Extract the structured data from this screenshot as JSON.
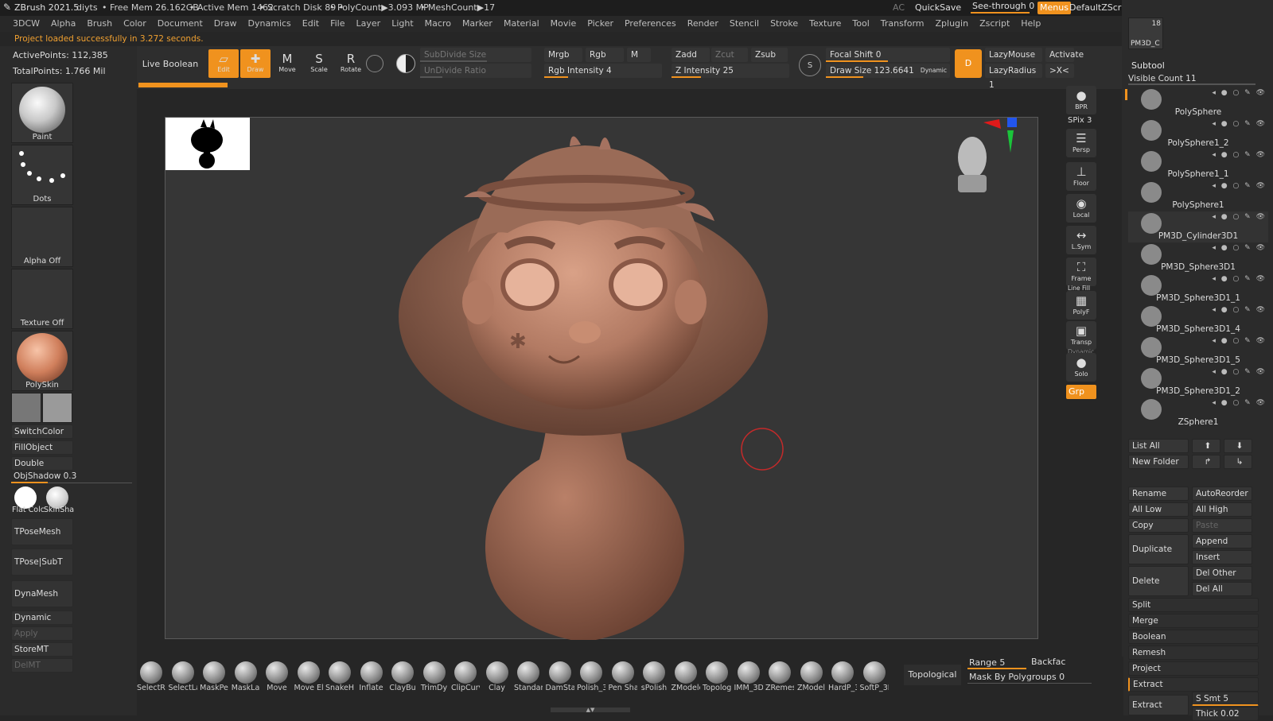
{
  "titlebar": {
    "app": "ZBrush 2021.5",
    "project": "diyts",
    "free_mem": "• Free Mem 26.162GB",
    "active_mem": "• Active Mem 1462",
    "scratch": "• Scratch Disk 89 •",
    "polycount": "• PolyCount▶3.093 MP",
    "meshcount": "• MeshCount▶17",
    "ac": "AC",
    "quicksave": "QuickSave",
    "see_through": "See-through  0",
    "menus": "Menus",
    "script": "DefaultZScript"
  },
  "menu": [
    "3DCW",
    "Alpha",
    "Brush",
    "Color",
    "Document",
    "Draw",
    "Dynamics",
    "Edit",
    "File",
    "Layer",
    "Light",
    "Macro",
    "Marker",
    "Material",
    "Movie",
    "Picker",
    "Preferences",
    "Render",
    "Stencil",
    "Stroke",
    "Texture",
    "Tool",
    "Transform",
    "Zplugin",
    "Zscript",
    "Help"
  ],
  "status": "Project loaded successfully in 3.272 seconds.",
  "stats": {
    "active_points": "ActivePoints: 112,385",
    "total_points": "TotalPoints: 1.766 Mil"
  },
  "left": {
    "brush": "Paint",
    "stroke": "Dots",
    "alpha": "Alpha Off",
    "texture": "Texture Off",
    "material": "PolySkin",
    "switch_color": "SwitchColor",
    "fill_object": "FillObject",
    "double": "Double",
    "objshadow_label": "ObjShadow",
    "objshadow_value": "0.3",
    "flat_color": "Flat Colc",
    "skin_shade": "SkinSha",
    "tpose_mesh": "TPoseMesh",
    "tpose_subt": "TPose|SubT",
    "dynamesh": "DynaMesh",
    "dynamic": "Dynamic",
    "apply": "Apply",
    "storemt": "StoreMT",
    "delmt": "DelMT"
  },
  "toolbar": {
    "live_boolean": "Live Boolean",
    "edit": "Edit",
    "draw": "Draw",
    "move": "Move",
    "scale": "Scale",
    "rotate": "Rotate",
    "subdivide_size": "SubDivide Size",
    "undivide_ratio": "UnDivide Ratio",
    "mrgb": "Mrgb",
    "rgb": "Rgb",
    "m": "M",
    "rgb_intensity": "Rgb Intensity 4",
    "zadd": "Zadd",
    "zcut": "Zcut",
    "zsub": "Zsub",
    "z_intensity": "Z Intensity 25",
    "focal_shift": "Focal Shift 0",
    "draw_size": "Draw Size 123.6641",
    "dynamic": "Dynamic",
    "lazymouse": "LazyMouse",
    "lazyradius": "LazyRadius 1",
    "activate": "Activate",
    "xc": ">X<",
    "s": "S",
    "d": "D",
    "rgb_intensity_level": 0.2,
    "z_intensity_level": 0.25,
    "focal_shift_level": 0.5,
    "draw_size_level": 0.3
  },
  "right_shelf": {
    "bpr": "BPR",
    "spix": "SPix 3",
    "persp": "Persp",
    "floor": "Floor",
    "local": "Local",
    "lsym": "L.Sym",
    "frame": "Frame",
    "linefill": "Line Fill",
    "polyf": "PolyF",
    "transp": "Transp",
    "dynamic": "Dynamic",
    "solo": "Solo",
    "grp": "Grp"
  },
  "subtool": {
    "thumb_count": "18",
    "thumb_name": "PM3D_C",
    "title": "Subtool",
    "visible_count": "Visible Count 11",
    "items": [
      "PolySphere",
      "PolySphere1_2",
      "PolySphere1_1",
      "PolySphere1",
      "PM3D_Cylinder3D1",
      "PM3D_Sphere3D1",
      "PM3D_Sphere3D1_1",
      "PM3D_Sphere3D1_4",
      "PM3D_Sphere3D1_5",
      "PM3D_Sphere3D1_2",
      "ZSphere1"
    ],
    "list_all": "List All",
    "new_folder": "New Folder",
    "rename": "Rename",
    "autoreorder": "AutoReorder",
    "all_low": "All Low",
    "all_high": "All High",
    "copy": "Copy",
    "paste": "Paste",
    "duplicate": "Duplicate",
    "append": "Append",
    "insert": "Insert",
    "delete": "Delete",
    "del_other": "Del Other",
    "del_all": "Del All",
    "split": "Split",
    "merge": "Merge",
    "boolean": "Boolean",
    "remesh": "Remesh",
    "project": "Project",
    "extract": "Extract",
    "extract_btn": "Extract",
    "s_smt": "S Smt 5",
    "thick": "Thick 0.02"
  },
  "bottom": {
    "brushes": [
      "SelectRe",
      "SelectLa",
      "MaskPe",
      "MaskLa",
      "Move",
      "Move El",
      "SnakeHo",
      "Inflate",
      "ClayBu",
      "TrimDy",
      "ClipCurv",
      "Clay",
      "Standar",
      "DamSta",
      "Polish_3",
      "Pen Sha",
      "sPolish",
      "ZModele",
      "Topolog",
      "IMM_3D",
      "ZRemes",
      "ZModel",
      "HardP_3",
      "SoftP_3D"
    ],
    "topological": "Topological",
    "range": "Range 5",
    "backface": "Backfac",
    "mask_by_polygroups": "Mask By Polygroups 0"
  },
  "colors": {
    "accent": "#f0921e",
    "bg": "#262626",
    "clay": "#b07865"
  }
}
